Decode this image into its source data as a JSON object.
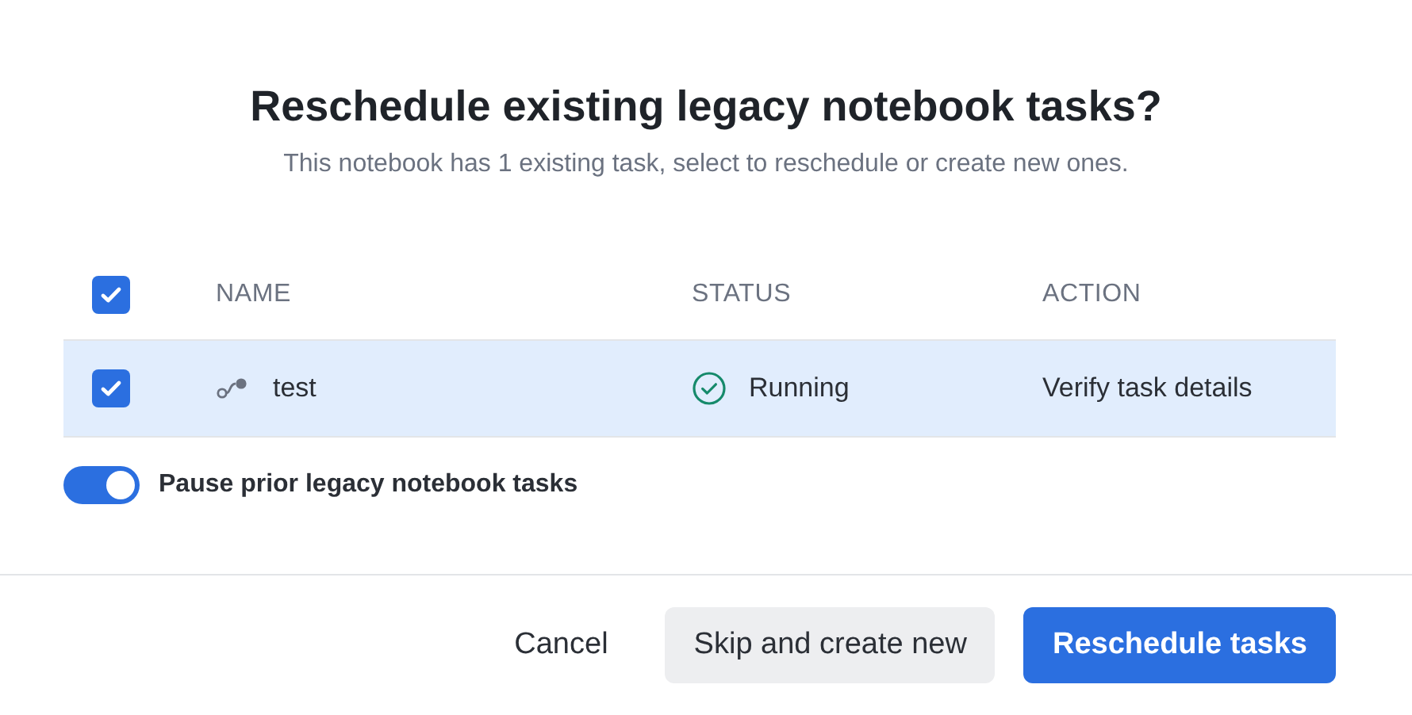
{
  "dialog": {
    "title": "Reschedule existing legacy notebook tasks?",
    "subtitle": "This notebook has 1 existing task, select to reschedule or create new ones."
  },
  "table": {
    "select_all_checked": true,
    "columns": [
      "NAME",
      "STATUS",
      "ACTION"
    ],
    "rows": [
      {
        "checked": true,
        "selected": true,
        "name": "test",
        "status": "Running",
        "action": "Verify task details"
      }
    ]
  },
  "pause_toggle": {
    "on": true,
    "label": "Pause prior legacy notebook tasks"
  },
  "buttons": [
    {
      "kind": "text",
      "label": "Cancel"
    },
    {
      "kind": "secondary",
      "label": "Skip and create new"
    },
    {
      "kind": "primary",
      "label": "Reschedule tasks"
    }
  ]
}
